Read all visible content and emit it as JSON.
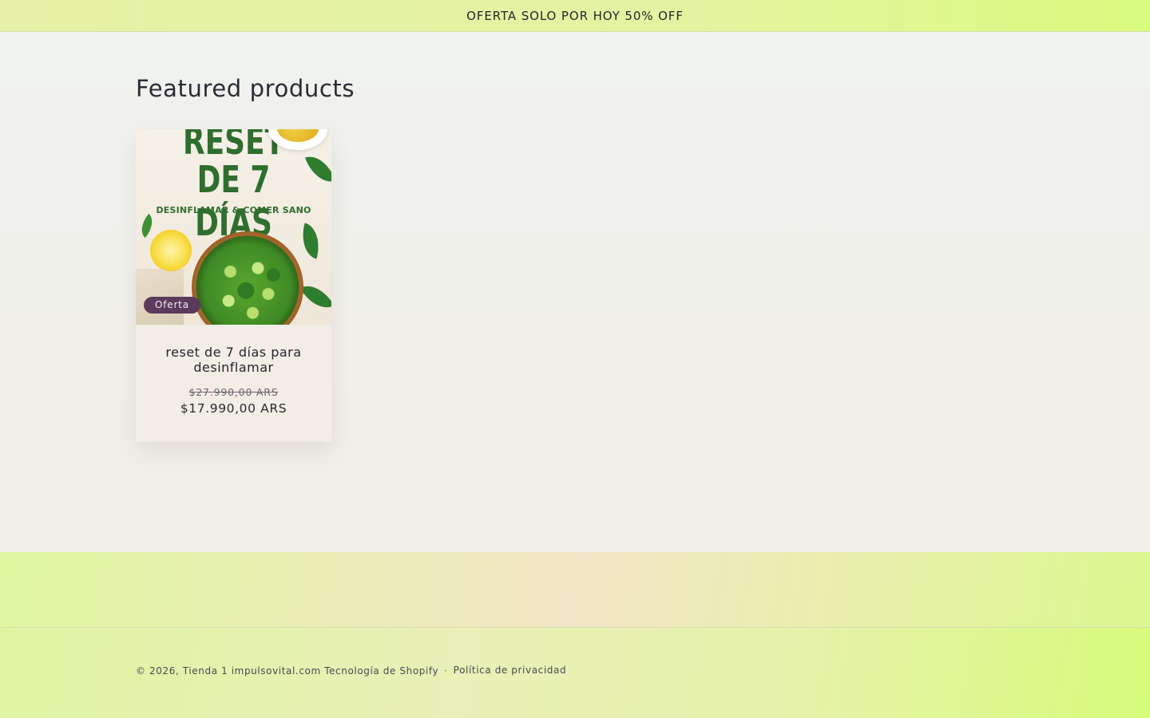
{
  "announcement": {
    "text": "OFERTA SOLO POR HOY 50% OFF"
  },
  "section": {
    "title": "Featured products"
  },
  "product": {
    "image": {
      "title_line_1": "RESET",
      "title_line_2": "DE 7 DÍAS",
      "subtitle": "DESINFLAMAR & COMER SANO"
    },
    "badge": "Oferta",
    "title": "reset de 7 días para desinflamar",
    "price_regular": "$27.990,00 ARS",
    "price_sale": "$17.990,00 ARS"
  },
  "footer": {
    "copyright_prefix": "© 2026, ",
    "store_link": "Tienda 1 impulsovital.com",
    "powered_by": "Tecnología de Shopify",
    "separator": "·",
    "privacy_link": "Política de privacidad"
  },
  "colors": {
    "badge_bg": "#5b3a5c",
    "title_green": "#2f6e2e",
    "announcement_bg": "#e3f3a0"
  }
}
